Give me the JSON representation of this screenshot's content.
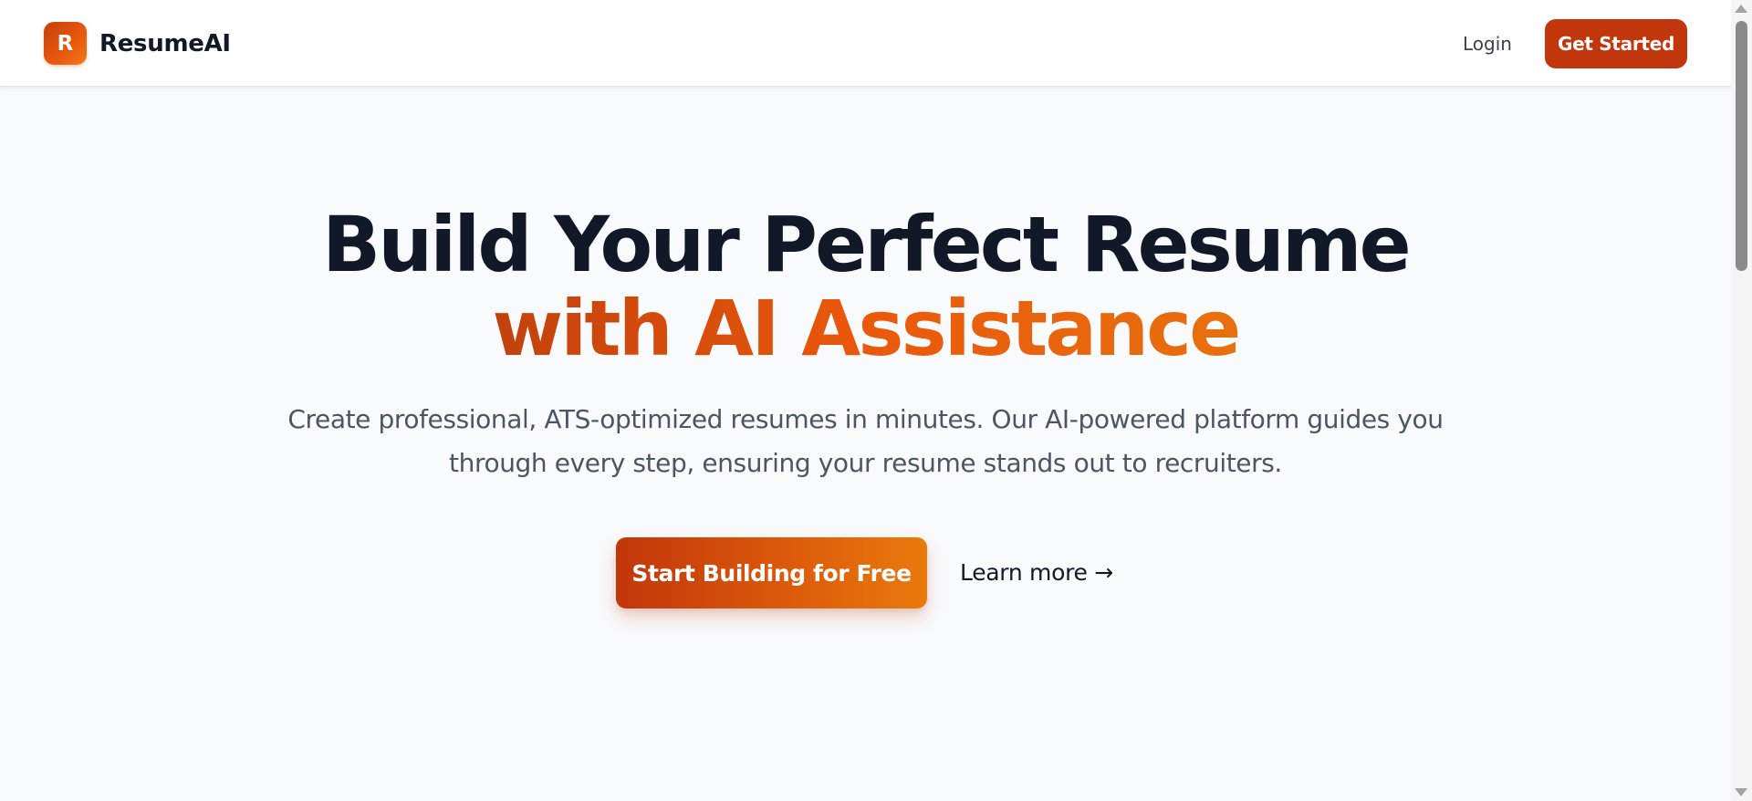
{
  "brand": {
    "logo_letter": "R",
    "name": "ResumeAI"
  },
  "nav": {
    "login_label": "Login",
    "get_started_label": "Get Started"
  },
  "hero": {
    "headline_line1": "Build Your Perfect Resume",
    "headline_line2": "with AI Assistance",
    "subtitle_line1": "Create professional, ATS-optimized resumes in minutes. Our AI-powered platform guides you",
    "subtitle_line2": "through every step, ensuring your resume stands out to recruiters.",
    "primary_cta_label": "Start Building for Free",
    "secondary_cta_label": "Learn more →"
  },
  "colors": {
    "brand_orange": "#c2410c",
    "accent_gradient_start": "#c2410c",
    "accent_gradient_end": "#e8700e",
    "heading_dark": "#111827",
    "body_text": "#4b5563",
    "page_background": "#f9fafb"
  },
  "icons": {
    "scroll_up": "triangle-up-icon",
    "scroll_down": "triangle-down-icon"
  }
}
